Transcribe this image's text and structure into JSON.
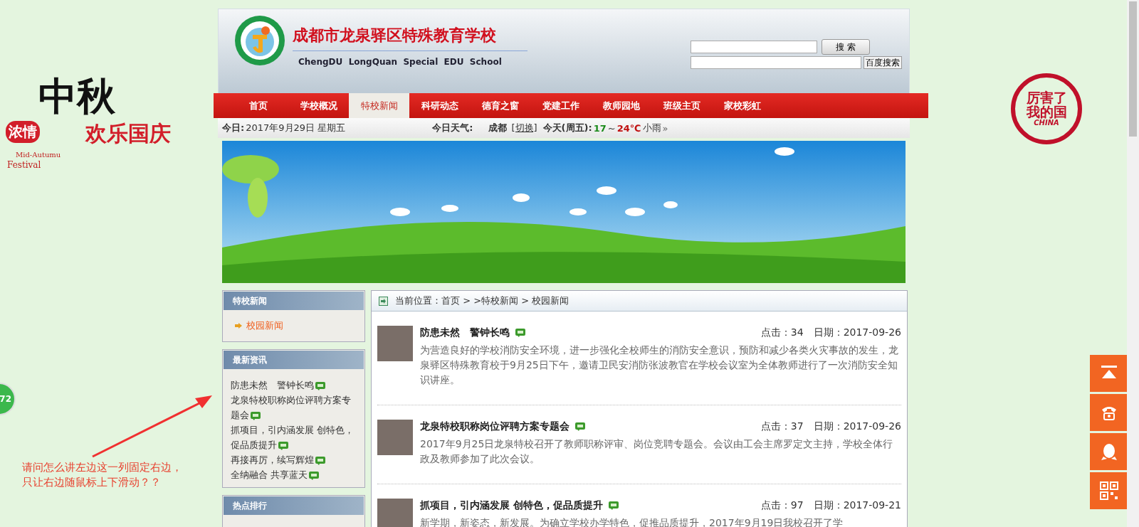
{
  "decor_left": {
    "texts": [
      "浓情",
      "中秋",
      "欢乐国庆",
      "Mid-Autumu",
      "Festival"
    ]
  },
  "decor_right": {
    "texts": [
      "厉害了",
      "我的国",
      "CHINA"
    ]
  },
  "side_badge": {
    "count": "72"
  },
  "annotation": {
    "lines": [
      "请问怎么讲左边这一列固定右边，",
      "只让右边随鼠标上下滑动？？"
    ]
  },
  "header": {
    "title": "成都市龙泉驿区特殊教育学校",
    "subtitle": "ChengDU  LongQuan  Special  EDU  School",
    "search_button": "搜 索",
    "baidu_button": "百度搜索"
  },
  "nav": [
    {
      "label": "首页",
      "selected": false
    },
    {
      "label": "学校概况",
      "selected": false
    },
    {
      "label": "特校新闻",
      "selected": true
    },
    {
      "label": "科研动态",
      "selected": false
    },
    {
      "label": "德育之窗",
      "selected": false
    },
    {
      "label": "党建工作",
      "selected": false
    },
    {
      "label": "教师园地",
      "selected": false
    },
    {
      "label": "班级主页",
      "selected": false
    },
    {
      "label": "家校彩虹",
      "selected": false
    }
  ],
  "info_bar": {
    "date_label": "今日:",
    "date": "2017年9月29日 星期五",
    "weather_label": "今日天气:",
    "city": "成都",
    "switch": "[切换]",
    "day": "今天(周五):",
    "low": "17",
    "sep": "~",
    "high": "24℃",
    "condition": "小雨",
    "more": "»"
  },
  "sidebar": [
    {
      "title": "特校新闻",
      "kind": "category",
      "items": [
        {
          "text": "校园新闻",
          "new": false
        }
      ]
    },
    {
      "title": "最新资讯",
      "kind": "news",
      "items": [
        {
          "text": "防患未然　警钟长鸣",
          "new": true
        },
        {
          "text": "龙泉特校职称岗位评聘方案专题会",
          "new": true
        },
        {
          "text": "抓项目，引内涵发展 创特色，促品质提升",
          "new": true
        },
        {
          "text": "再接再厉，续写辉煌",
          "new": true
        },
        {
          "text": "全纳融合 共享蓝天",
          "new": true
        }
      ]
    },
    {
      "title": "热点排行",
      "kind": "hot"
    }
  ],
  "breadcrumb": "当前位置：首页 > >特校新闻 > 校园新闻",
  "articles": [
    {
      "title": "防患未然　警钟长鸣",
      "new": true,
      "hits": "点击：34",
      "date": "日期：2017-09-26",
      "summary": "为营造良好的学校消防安全环境，进一步强化全校师生的消防安全意识，预防和减少各类火灾事故的发生，龙泉驿区特殊教育校于9月25日下午，邀请卫民安消防张波教官在学校会议室为全体教师进行了一次消防安全知识讲座。"
    },
    {
      "title": "龙泉特校职称岗位评聘方案专题会",
      "new": true,
      "hits": "点击：37",
      "date": "日期：2017-09-26",
      "summary": "2017年9月25日龙泉特校召开了教师职称评审、岗位竞聘专题会。会议由工会主席罗定文主持，学校全体行政及教师参加了此次会议。"
    },
    {
      "title": "抓项目，引内涵发展 创特色，促品质提升",
      "new": true,
      "hits": "点击：97",
      "date": "日期：2017-09-21",
      "summary": "新学期，新姿态，新发展。为确立学校办学特色，促推品质提升，2017年9月19日我校召开了学"
    }
  ]
}
